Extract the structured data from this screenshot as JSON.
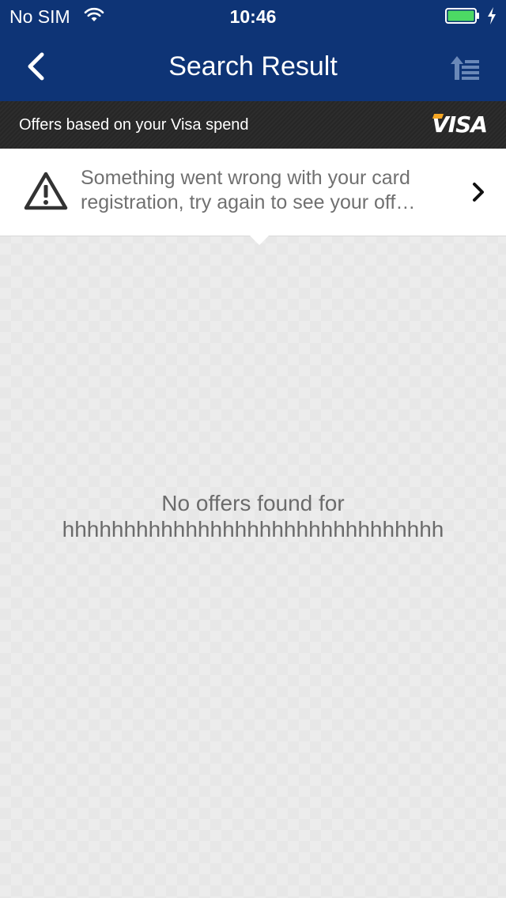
{
  "status_bar": {
    "carrier": "No SIM",
    "time": "10:46",
    "battery_level": 1.0
  },
  "nav": {
    "title": "Search Result",
    "back_icon": "chevron-left-icon",
    "sort_icon": "sort-list-icon"
  },
  "visa_strip": {
    "text": "Offers based on your Visa spend",
    "logo_text": "VISA"
  },
  "error_banner": {
    "line1": "Something went wrong with your card",
    "line2": "registration, try again to see your off…",
    "icon": "warning-icon"
  },
  "empty_state": {
    "line1": "No offers found for",
    "line2": "hhhhhhhhhhhhhhhhhhhhhhhhhhhhhhh"
  },
  "colors": {
    "nav_blue": "#0e3476",
    "visa_strip": "#262626",
    "battery_green": "#4cd964",
    "visa_gold": "#f5a623"
  }
}
